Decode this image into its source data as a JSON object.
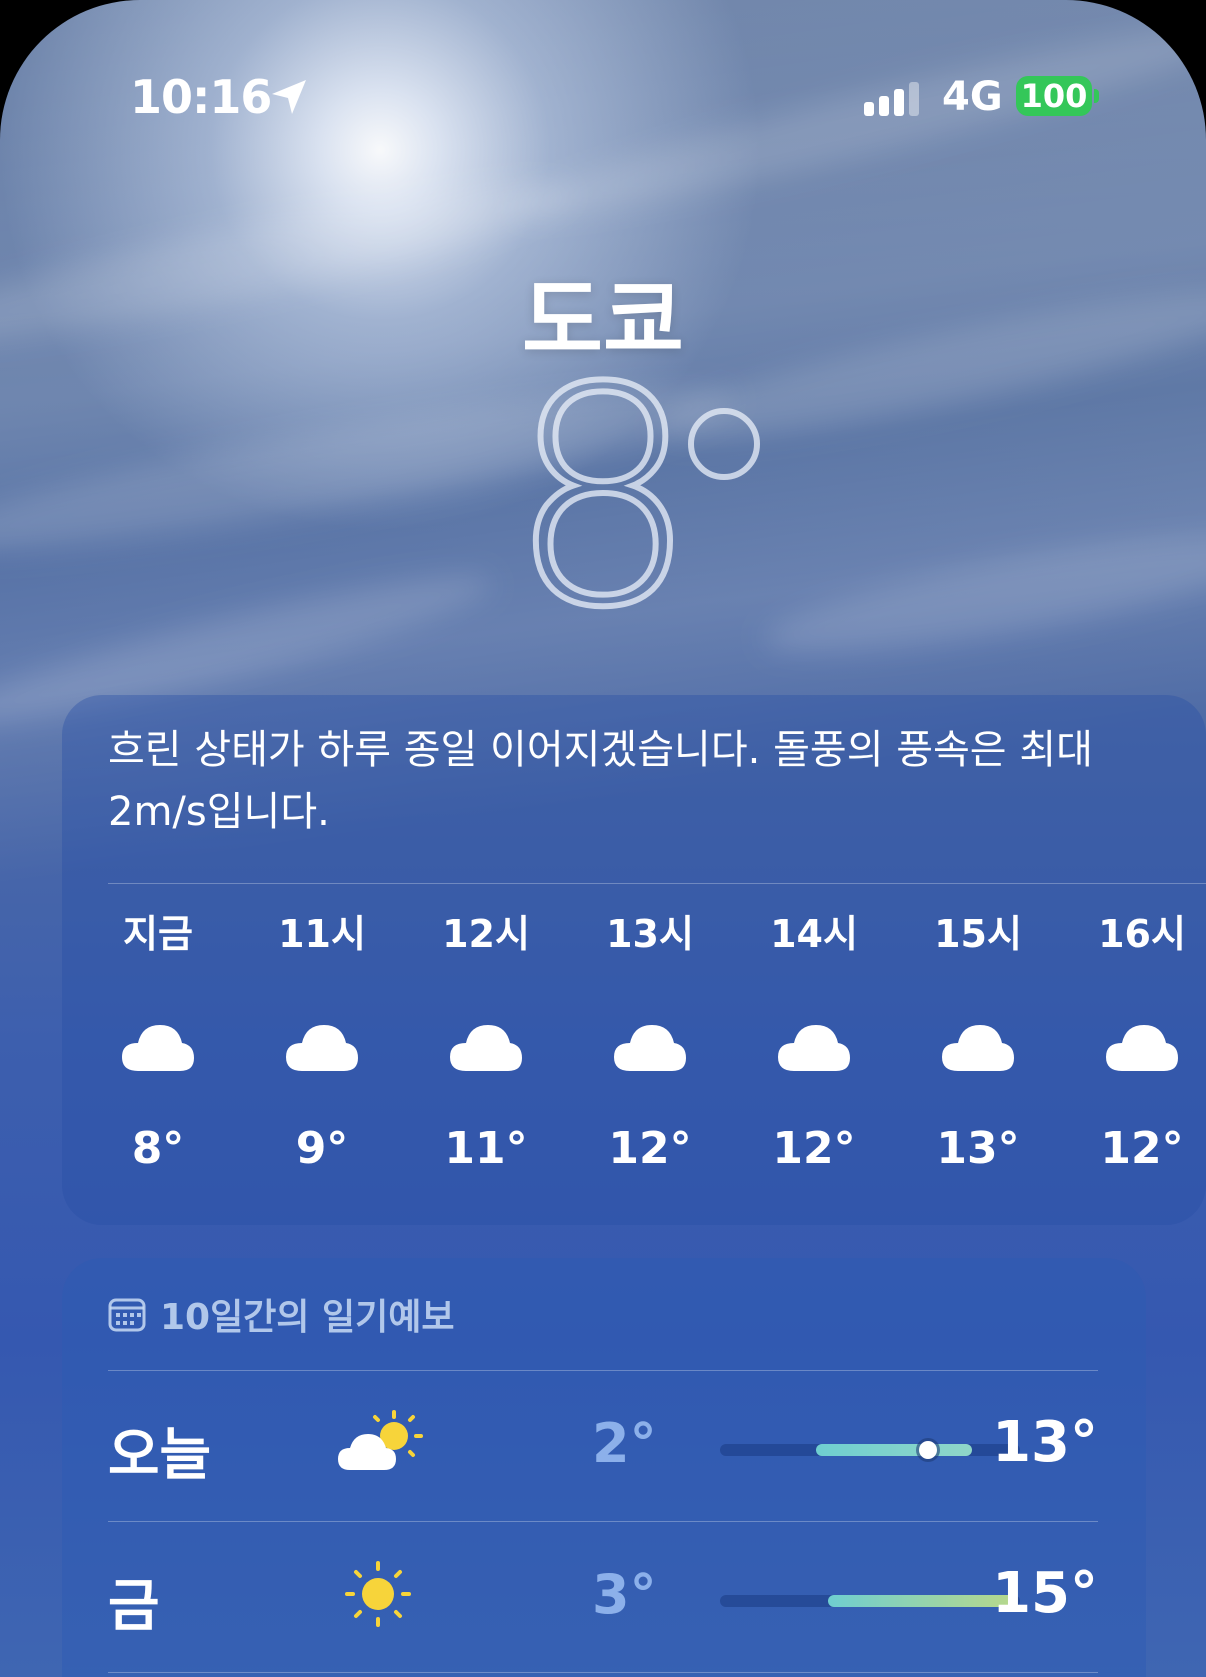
{
  "status_bar": {
    "time": "10:16",
    "network": "4G",
    "battery": "100",
    "battery_color": "#34c759"
  },
  "location": {
    "city": "도쿄",
    "current_temp": "8"
  },
  "hourly": {
    "summary": "흐린 상태가 하루 종일 이어지겠습니다. 돌풍의 풍속은 최대 2m/s입니다.",
    "items": [
      {
        "label": "지금",
        "icon": "cloud-icon",
        "temp": "8°"
      },
      {
        "label": "11시",
        "icon": "cloud-icon",
        "temp": "9°"
      },
      {
        "label": "12시",
        "icon": "cloud-icon",
        "temp": "11°"
      },
      {
        "label": "13시",
        "icon": "cloud-icon",
        "temp": "12°"
      },
      {
        "label": "14시",
        "icon": "cloud-icon",
        "temp": "12°"
      },
      {
        "label": "15시",
        "icon": "cloud-icon",
        "temp": "13°"
      },
      {
        "label": "16시",
        "icon": "cloud-icon",
        "temp": "12°"
      }
    ]
  },
  "forecast": {
    "header": "10일간의 일기예보",
    "days": [
      {
        "day": "오늘",
        "icon": "partly-cloudy-icon",
        "low": "2°",
        "high": "13°",
        "current_temp": 8,
        "range_min": 2,
        "range_max": 15
      },
      {
        "day": "금",
        "icon": "sun-icon",
        "low": "3°",
        "high": "15°",
        "range_min": 2,
        "range_max": 15
      }
    ]
  },
  "colors": {
    "sky_top": "#6e84aa",
    "sky_bottom": "#3558b0",
    "bar_today": "#6fcfd0",
    "bar_fri": "#b8d88a"
  }
}
